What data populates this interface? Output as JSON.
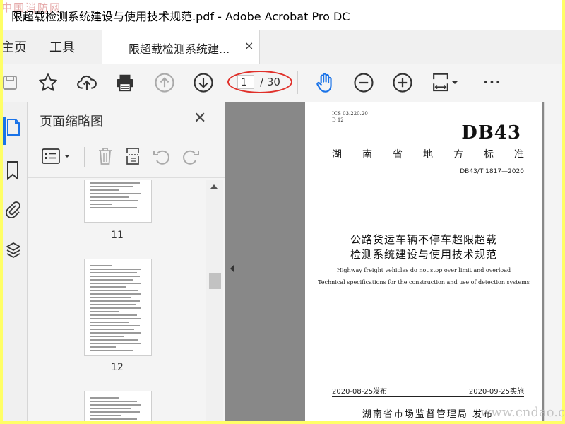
{
  "window": {
    "title": "限超载检测系统建设与使用技术规范.pdf - Adobe Acrobat Pro DC",
    "watermark_top": "中国消防网"
  },
  "tabs": {
    "home": "主页",
    "tools": "工具",
    "document": "限超载检测系统建...",
    "close_glyph": "×"
  },
  "toolbar": {
    "current_page": "1",
    "total_pages": "/ 30",
    "more": "•••"
  },
  "thumbnails": {
    "title": "页面缩略图",
    "close_glyph": "✕",
    "pages": [
      "11",
      "12"
    ]
  },
  "document": {
    "ics": "ICS 03.220.20",
    "ccs": "D 12",
    "code": "DB43",
    "province": [
      "湖",
      "南",
      "省",
      "地",
      "方",
      "标",
      "准"
    ],
    "standard_number": "DB43/T 1817—2020",
    "title_cn_line1": "公路货运车辆不停车超限超载",
    "title_cn_line2": "检测系统建设与使用技术规范",
    "title_en_line1": "Highway freight vehicles do not stop over limit and overload",
    "title_en_line2": "Technical specifications for the construction and use of detection systems",
    "issue_date": "2020-08-25发布",
    "effective_date": "2020-09-25实施",
    "issuer": "湖南省市场监督管理局 发布"
  },
  "watermark_bottom": "www.cndao.c",
  "colors": {
    "outer_border": "#ffff66",
    "annotation_ellipse": "#e0302a",
    "hand_tool_active": "#1a73e8",
    "viewer_bg": "#888888"
  }
}
